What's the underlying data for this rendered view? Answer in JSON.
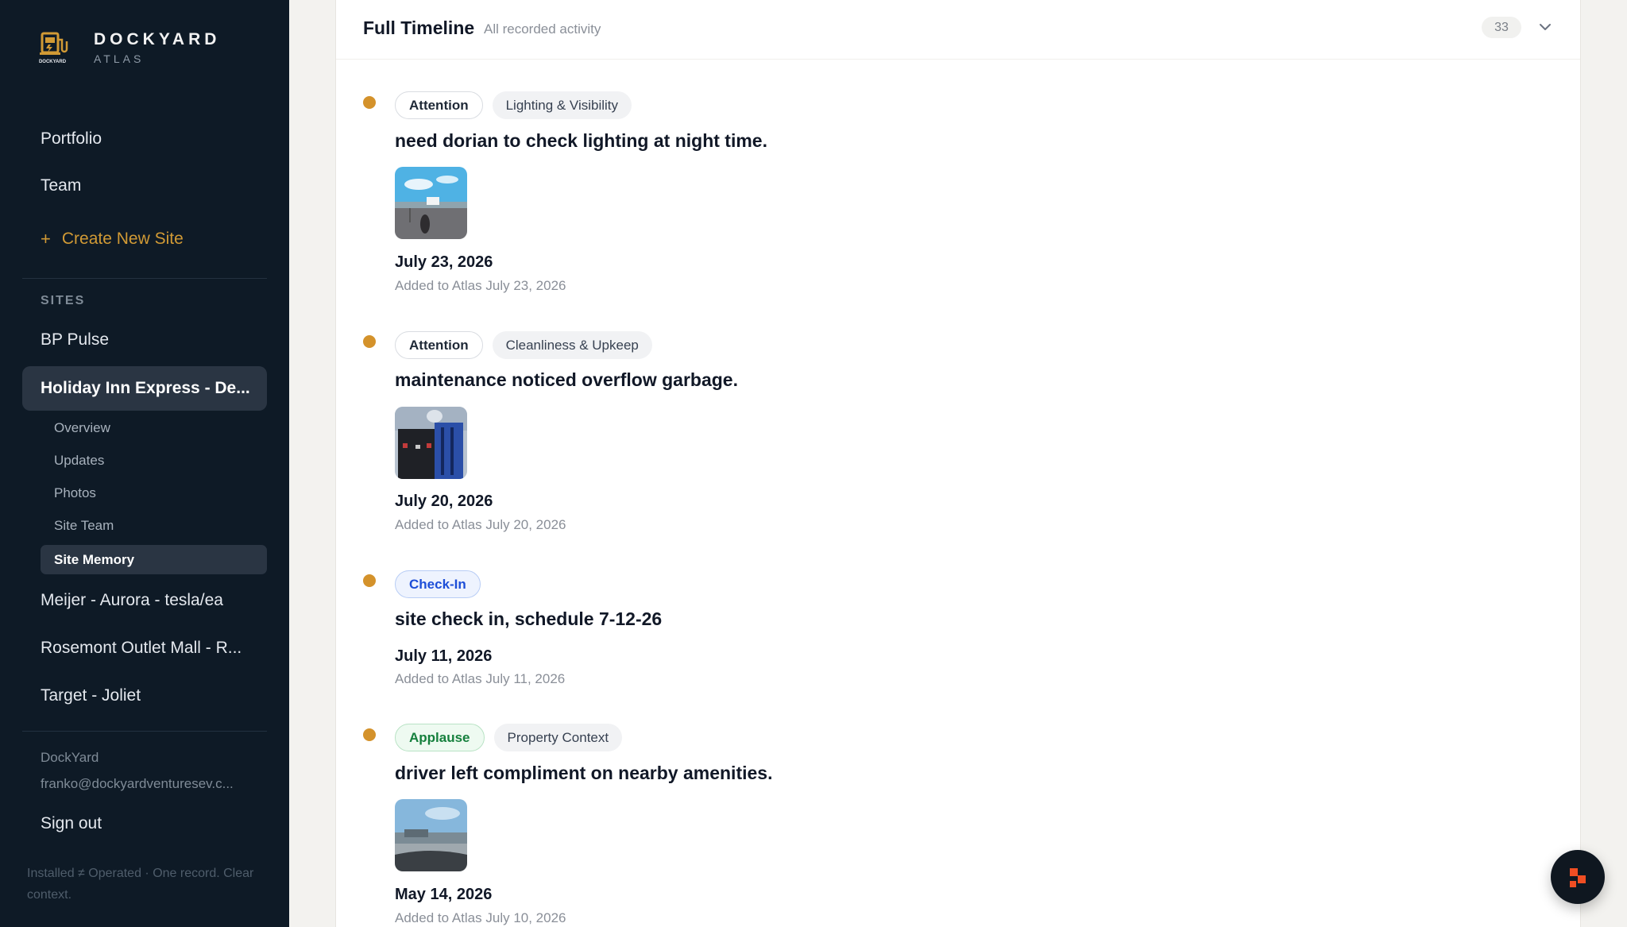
{
  "brand": {
    "name": "DOCKYARD",
    "sub": "ATLAS",
    "logo_text": "DOCKYARD"
  },
  "nav": {
    "portfolio": "Portfolio",
    "team": "Team",
    "create_site": "Create New Site"
  },
  "sites_label": "SITES",
  "sites": [
    "BP Pulse",
    "Holiday Inn Express - De...",
    "Meijer - Aurora - tesla/ea",
    "Rosemont Outlet Mall - R...",
    "Target - Joliet"
  ],
  "site_subnav": [
    "Overview",
    "Updates",
    "Photos",
    "Site Team",
    "Site Memory"
  ],
  "account": {
    "name": "DockYard",
    "email": "franko@dockyardventuresev.c...",
    "sign_out": "Sign out"
  },
  "tagline": "Installed ≠ Operated · One record. Clear context.",
  "panel": {
    "title": "Full Timeline",
    "subtitle": "All recorded activity",
    "count": "33"
  },
  "timeline": [
    {
      "status": "Attention",
      "category": "Lighting & Visibility",
      "title": "need dorian to check lighting at night time.",
      "photo": "parking-lot-photo",
      "date": "July 23, 2026",
      "added": "Added to Atlas July 23, 2026"
    },
    {
      "status": "Attention",
      "category": "Cleanliness & Upkeep",
      "title": "maintenance noticed overflow garbage.",
      "photo": "trash-bin-photo",
      "date": "July 20, 2026",
      "added": "Added to Atlas July 20, 2026"
    },
    {
      "status": "Check-In",
      "category": "",
      "title": "site check in, schedule 7-12-26",
      "photo": "",
      "date": "July 11, 2026",
      "added": "Added to Atlas July 11, 2026"
    },
    {
      "status": "Applause",
      "category": "Property Context",
      "title": "driver left compliment on nearby amenities.",
      "photo": "windshield-view-photo",
      "date": "May 14, 2026",
      "added": "Added to Atlas July 10, 2026"
    }
  ],
  "colors": {
    "sidebar_bg": "#0e1a26",
    "accent": "#d19a35",
    "dot": "#d4922b",
    "checkin": "#1d4ed8",
    "applause": "#15803d"
  }
}
